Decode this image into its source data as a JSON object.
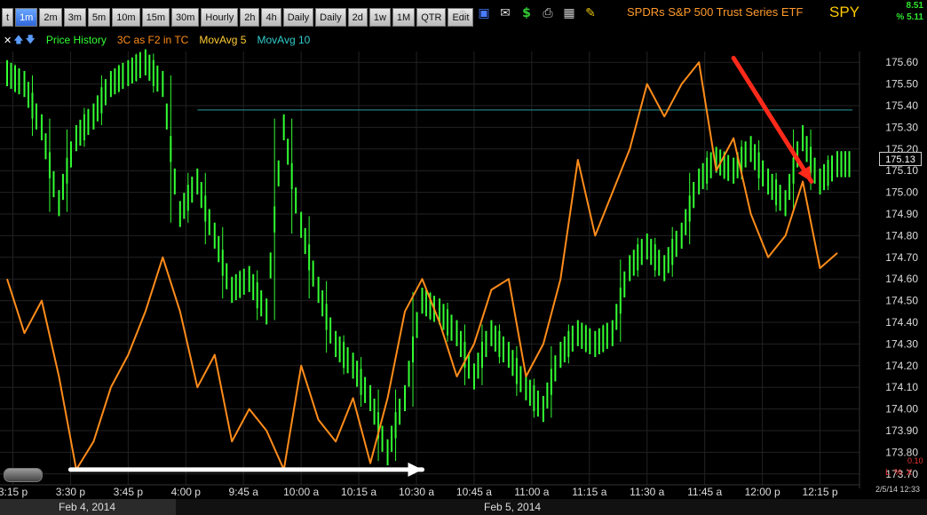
{
  "toolbar": {
    "timeframes": [
      "t",
      "1m",
      "2m",
      "3m",
      "5m",
      "10m",
      "15m",
      "30m",
      "Hourly",
      "2h",
      "4h",
      "Daily",
      "Daily",
      "2d",
      "1w",
      "1M",
      "QTR",
      "Edit"
    ],
    "active_index": 1,
    "icons": [
      "link-icon",
      "save-icon",
      "mail-icon",
      "dollar-icon",
      "print-icon",
      "grid-icon",
      "pencil-icon"
    ]
  },
  "header": {
    "etf_name": "SPDRs S&P 500 Trust Series ETF",
    "symbol": "SPY",
    "change_value": "8.51",
    "change_pct": "% 5.11"
  },
  "legend": {
    "items": [
      {
        "label": "Price History",
        "color": "#33ff33"
      },
      {
        "label": "3C as F2 in TC",
        "color": "#ff8c1a"
      },
      {
        "label": "MovAvg 5",
        "color": "#ffcc33"
      },
      {
        "label": "MovAvg 10",
        "color": "#33cccc"
      }
    ]
  },
  "chart_data": {
    "type": "line",
    "x_ticks": [
      "3:15 p",
      "3:30 p",
      "3:45 p",
      "4:00 p",
      "9:45 a",
      "10:00 a",
      "10:15 a",
      "10:30 a",
      "10:45 a",
      "11:00 a",
      "11:15 a",
      "11:30 a",
      "11:45 a",
      "12:00 p",
      "12:15 p"
    ],
    "y_ticks": [
      175.6,
      175.5,
      175.4,
      175.3,
      175.2,
      175.1,
      175.0,
      174.9,
      174.8,
      174.7,
      174.6,
      174.5,
      174.4,
      174.3,
      174.2,
      174.1,
      174.0,
      173.9,
      173.8,
      173.7
    ],
    "ylim": [
      173.65,
      175.65
    ],
    "last_price": "175.13",
    "reference_line": 175.38,
    "series": [
      {
        "name": "Price History",
        "color": "#33ff33",
        "x": [
          0,
          0.3,
          0.6,
          0.9,
          1.2,
          1.5,
          1.8,
          2.1,
          2.4,
          2.7,
          3,
          3.3,
          3.6,
          3.9,
          4.2,
          4.5,
          4.8,
          5.1,
          5.4,
          5.7,
          6,
          6.3,
          6.6,
          6.9,
          7.2,
          7.5,
          7.8,
          8.1,
          8.4,
          8.7,
          9,
          9.3,
          9.6,
          9.9,
          10.2,
          10.5,
          10.8,
          11.1,
          11.4,
          11.7,
          12,
          12.3,
          12.6,
          12.9,
          13.2,
          13.5,
          13.8,
          14.1,
          14.4
        ],
        "values": [
          175.55,
          175.5,
          175.3,
          174.95,
          175.25,
          175.35,
          175.5,
          175.55,
          175.6,
          175.5,
          174.9,
          175.05,
          174.8,
          174.55,
          174.6,
          174.45,
          175.3,
          174.85,
          174.55,
          174.3,
          174.2,
          174.05,
          173.8,
          174.05,
          174.5,
          174.45,
          174.35,
          174.15,
          174.35,
          174.25,
          174.1,
          174.0,
          174.25,
          174.35,
          174.3,
          174.35,
          174.65,
          174.75,
          174.65,
          174.8,
          175.05,
          175.15,
          175.1,
          175.2,
          175.05,
          174.95,
          175.25,
          175.05,
          175.13
        ]
      },
      {
        "name": "3C as F2 in TC",
        "color": "#ff8c1a",
        "x": [
          0,
          0.3,
          0.6,
          0.9,
          1.2,
          1.5,
          1.8,
          2.1,
          2.4,
          2.7,
          3,
          3.3,
          3.6,
          3.9,
          4.2,
          4.5,
          4.8,
          5.1,
          5.4,
          5.7,
          6,
          6.3,
          6.6,
          6.9,
          7.2,
          7.5,
          7.8,
          8.1,
          8.4,
          8.7,
          9,
          9.3,
          9.6,
          9.9,
          10.2,
          10.5,
          10.8,
          11.1,
          11.4,
          11.7,
          12,
          12.3,
          12.6,
          12.9,
          13.2,
          13.5,
          13.8,
          14.1,
          14.4
        ],
        "values": [
          174.6,
          174.35,
          174.5,
          174.15,
          173.72,
          173.85,
          174.1,
          174.25,
          174.45,
          174.7,
          174.45,
          174.1,
          174.25,
          173.85,
          174.0,
          173.9,
          173.72,
          174.2,
          173.95,
          173.85,
          174.05,
          173.75,
          174.05,
          174.45,
          174.6,
          174.4,
          174.15,
          174.3,
          174.55,
          174.6,
          174.15,
          174.3,
          174.6,
          175.15,
          174.8,
          175.0,
          175.2,
          175.5,
          175.35,
          175.5,
          175.6,
          175.1,
          175.25,
          174.9,
          174.7,
          174.8,
          175.05,
          174.65,
          174.72
        ]
      }
    ],
    "annotations": [
      {
        "type": "arrow",
        "color": "#ffffff",
        "from": [
          1.1,
          173.72
        ],
        "to": [
          7.2,
          173.72
        ]
      },
      {
        "type": "arrow",
        "color": "#ff2a1a",
        "from": [
          12.6,
          175.62
        ],
        "to": [
          13.95,
          175.05
        ]
      }
    ]
  },
  "bottom": {
    "date1": "Feb 4, 2014",
    "date2": "Feb 5, 2014",
    "timestamp": "2/5/14 12:33",
    "lwx_label": "L % X",
    "lwx_value": "0.10"
  }
}
